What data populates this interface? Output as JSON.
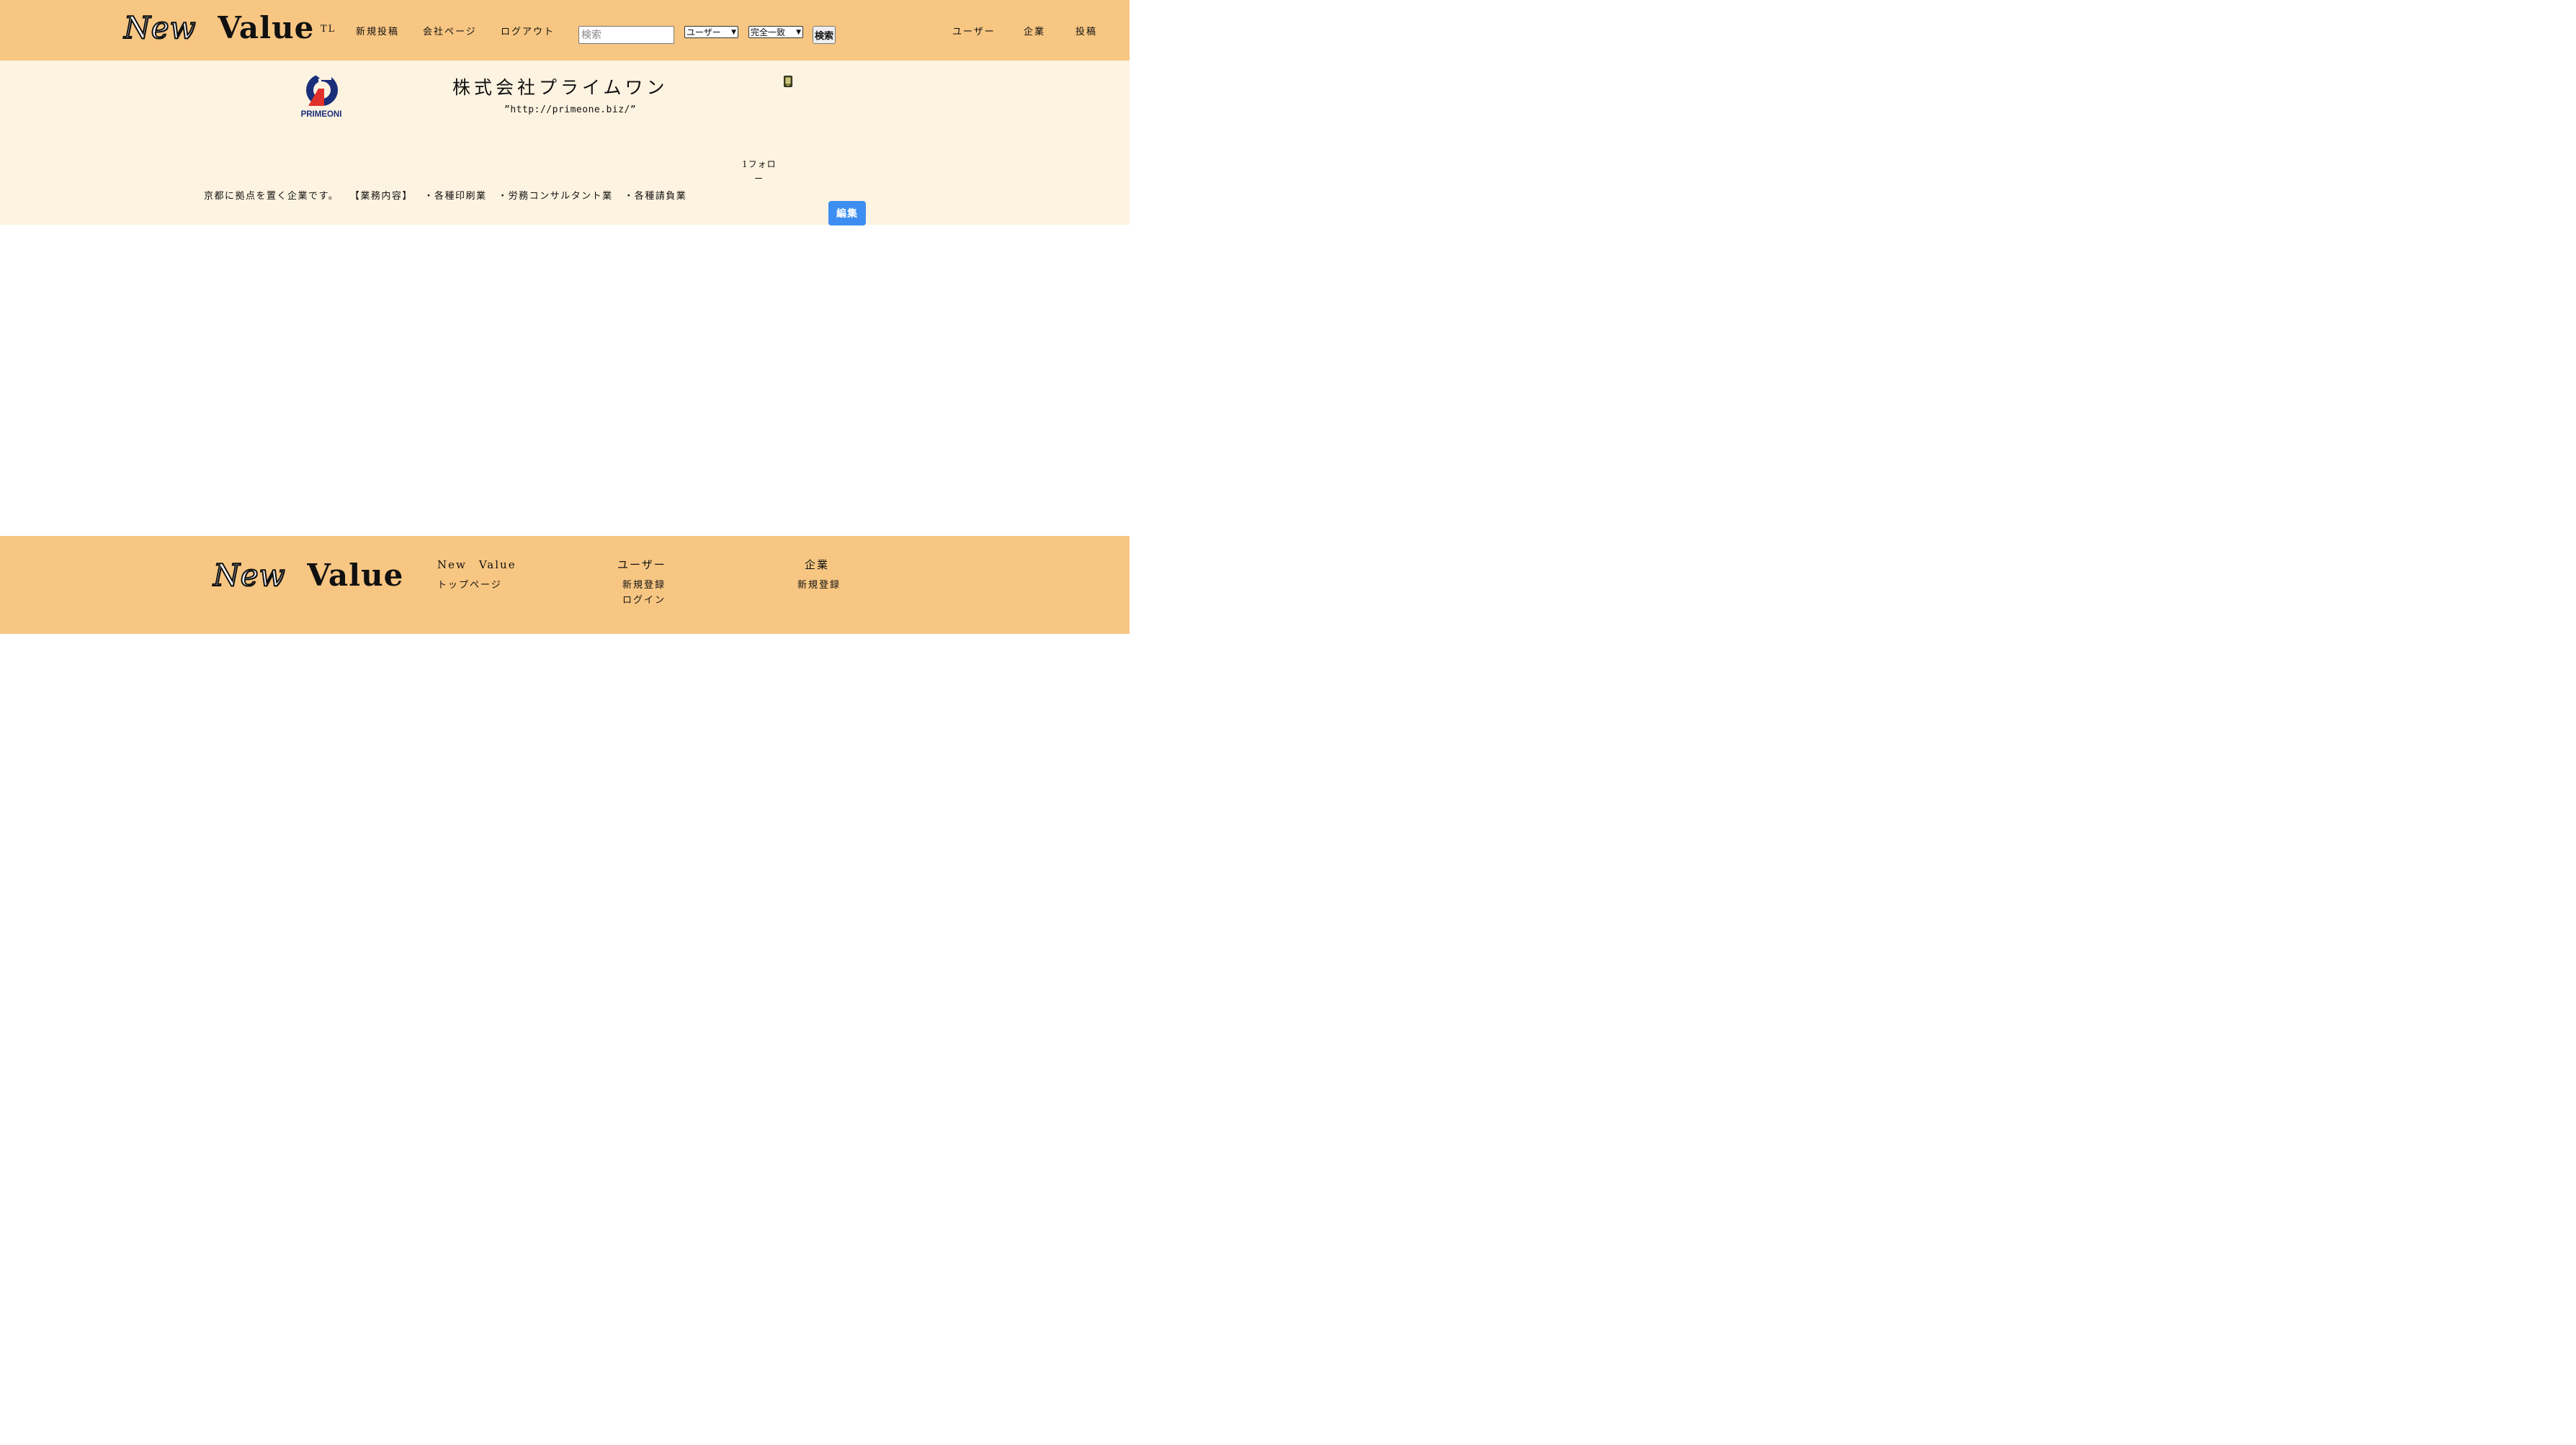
{
  "header": {
    "logo_word1": "New",
    "logo_word2": "Value",
    "nav": {
      "tl": "TL",
      "new_post": "新規投稿",
      "company_page": "会社ページ",
      "logout": "ログアウト"
    },
    "search": {
      "placeholder": "検索",
      "value": "",
      "type_select": "ユーザー",
      "match_select": "完全一致",
      "button": "検索"
    },
    "right_nav": {
      "users": "ユーザー",
      "companies": "企業",
      "posts": "投稿"
    }
  },
  "company": {
    "logo_text": "PRIMEONI",
    "name": "株式会社プライムワン",
    "url": "”http://primeone.biz/”",
    "follow_count": "1フォロ",
    "follow_dash": "ー",
    "description": "京都に拠点を置く企業です。 【業務内容】 ・各種印刷業 ・労務コンサルタント業 ・各種請負業",
    "edit_button": "編集"
  },
  "footer": {
    "logo_word1": "New",
    "logo_word2": "Value",
    "col1": {
      "heading": "New　Value",
      "links": [
        "トップページ"
      ]
    },
    "col2": {
      "heading": "ユーザー",
      "links": [
        "新規登録",
        "ログイン"
      ]
    },
    "col3": {
      "heading": "企業",
      "links": [
        "新規登録"
      ]
    }
  },
  "colors": {
    "header_bg": "#f7c682",
    "banner_bg": "#fdf3e1",
    "edit_button": "#3d8ef0"
  }
}
